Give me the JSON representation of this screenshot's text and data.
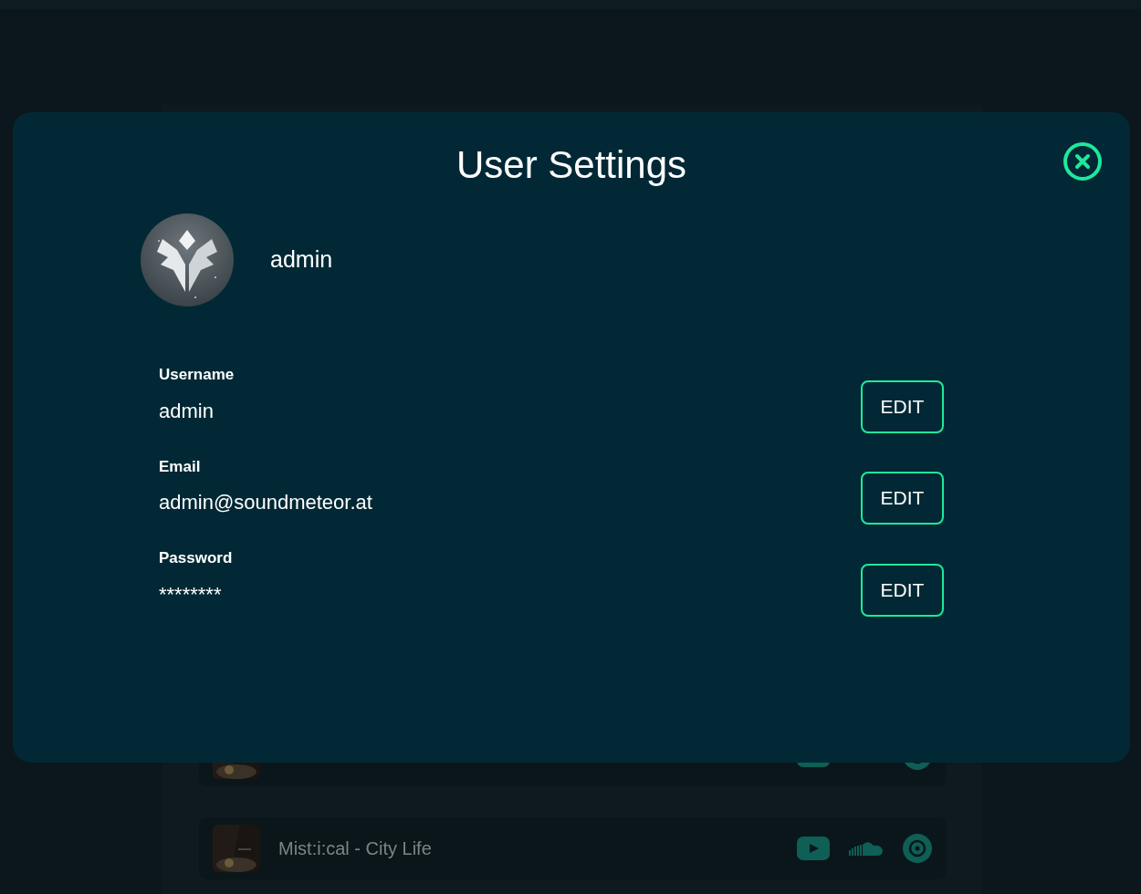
{
  "tracks": [
    {
      "icons": [
        {
          "kind": "play"
        },
        {
          "kind": "hidden"
        },
        {
          "kind": "target"
        }
      ]
    },
    {
      "title": "Mist:i:cal - City Life",
      "icons": [
        {
          "kind": "play"
        },
        {
          "kind": "cloud"
        },
        {
          "kind": "target"
        }
      ]
    }
  ],
  "modal": {
    "title": "User Settings",
    "profile": {
      "name": "admin",
      "avatar": {
        "kind": "logo"
      }
    },
    "fields": [
      {
        "label": "Username",
        "value": "admin",
        "button": "EDIT"
      },
      {
        "label": "Email",
        "value": "admin@soundmeteor.at",
        "button": "EDIT"
      },
      {
        "label": "Password",
        "value": "********",
        "button": "EDIT"
      }
    ]
  }
}
